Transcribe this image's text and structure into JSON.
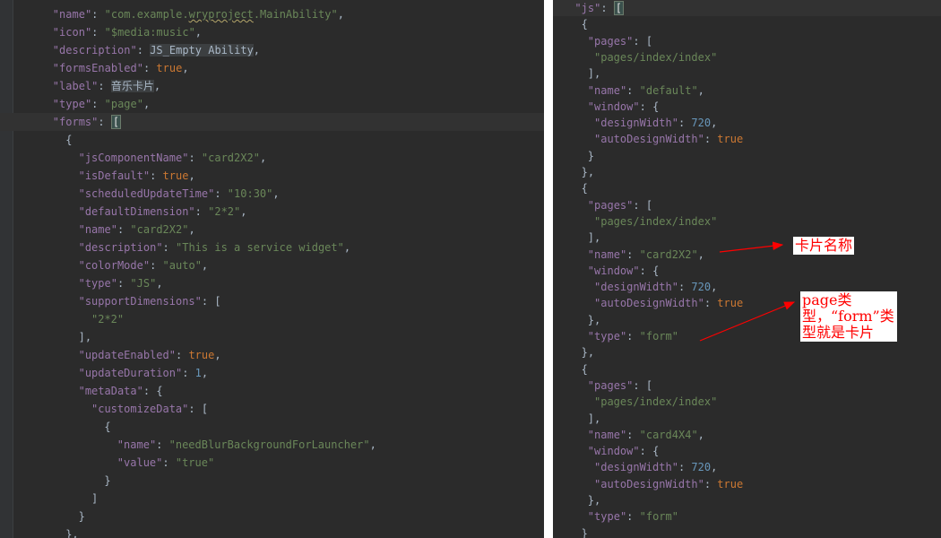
{
  "left_editor": {
    "lines": [
      {
        "ind": 4,
        "key": "name",
        "val": "com.example.",
        "val2": "wryproject",
        "val3": ".MainAbility",
        "kind": "str3"
      },
      {
        "ind": 4,
        "key": "icon",
        "val": "$media:music",
        "kind": "str"
      },
      {
        "ind": 4,
        "key": "description",
        "val": "JS_Empty Ability",
        "kind": "hlstr"
      },
      {
        "ind": 4,
        "key": "formsEnabled",
        "val": "true",
        "kind": "kw"
      },
      {
        "ind": 4,
        "key": "label",
        "val": "音乐卡片",
        "kind": "hlstr"
      },
      {
        "ind": 4,
        "key": "type",
        "val": "page",
        "kind": "str"
      },
      {
        "ind": 4,
        "key": "forms",
        "val": "[",
        "kind": "open"
      },
      {
        "ind": 6,
        "text": "{",
        "kind": "punct"
      },
      {
        "ind": 8,
        "key": "jsComponentName",
        "val": "card2X2",
        "kind": "str"
      },
      {
        "ind": 8,
        "key": "isDefault",
        "val": "true",
        "kind": "kw"
      },
      {
        "ind": 8,
        "key": "scheduledUpdateTime",
        "val": "10:30",
        "kind": "str"
      },
      {
        "ind": 8,
        "key": "defaultDimension",
        "val": "2*2",
        "kind": "str"
      },
      {
        "ind": 8,
        "key": "name",
        "val": "card2X2",
        "kind": "str"
      },
      {
        "ind": 8,
        "key": "description",
        "val": "This is a service widget",
        "kind": "str"
      },
      {
        "ind": 8,
        "key": "colorMode",
        "val": "auto",
        "kind": "str"
      },
      {
        "ind": 8,
        "key": "type",
        "val": "JS",
        "kind": "str"
      },
      {
        "ind": 8,
        "key": "supportDimensions",
        "val": "[",
        "kind": "openp"
      },
      {
        "ind": 10,
        "val": "2*2",
        "kind": "stronly"
      },
      {
        "ind": 8,
        "text": "],",
        "kind": "punct"
      },
      {
        "ind": 8,
        "key": "updateEnabled",
        "val": "true",
        "kind": "kw"
      },
      {
        "ind": 8,
        "key": "updateDuration",
        "val": "1",
        "kind": "num"
      },
      {
        "ind": 8,
        "key": "metaData",
        "val": "{",
        "kind": "openp"
      },
      {
        "ind": 10,
        "key": "customizeData",
        "val": "[",
        "kind": "openp"
      },
      {
        "ind": 12,
        "text": "{",
        "kind": "punct"
      },
      {
        "ind": 14,
        "key": "name",
        "val": "needBlurBackgroundForLauncher",
        "kind": "str"
      },
      {
        "ind": 14,
        "key": "value",
        "val": "true",
        "kind": "strlast"
      },
      {
        "ind": 12,
        "text": "}",
        "kind": "punct"
      },
      {
        "ind": 10,
        "text": "]",
        "kind": "punct"
      },
      {
        "ind": 8,
        "text": "}",
        "kind": "punct"
      },
      {
        "ind": 6,
        "text": "},",
        "kind": "punct"
      }
    ]
  },
  "right_editor": {
    "lines": [
      {
        "ind": 2,
        "key": "js",
        "val": "[",
        "kind": "open"
      },
      {
        "ind": 3,
        "text": "{",
        "kind": "punct"
      },
      {
        "ind": 4,
        "key": "pages",
        "val": "[",
        "kind": "openp"
      },
      {
        "ind": 5,
        "val": "pages/index/index",
        "kind": "stronly"
      },
      {
        "ind": 4,
        "text": "],",
        "kind": "punct"
      },
      {
        "ind": 4,
        "key": "name",
        "val": "default",
        "kind": "str"
      },
      {
        "ind": 4,
        "key": "window",
        "val": "{",
        "kind": "openp"
      },
      {
        "ind": 5,
        "key": "designWidth",
        "val": "720",
        "kind": "num"
      },
      {
        "ind": 5,
        "key": "autoDesignWidth",
        "val": "true",
        "kind": "kwlast"
      },
      {
        "ind": 4,
        "text": "}",
        "kind": "punct"
      },
      {
        "ind": 3,
        "text": "},",
        "kind": "punct"
      },
      {
        "ind": 3,
        "text": "{",
        "kind": "punct"
      },
      {
        "ind": 4,
        "key": "pages",
        "val": "[",
        "kind": "openp"
      },
      {
        "ind": 5,
        "val": "pages/index/index",
        "kind": "stronly"
      },
      {
        "ind": 4,
        "text": "],",
        "kind": "punct"
      },
      {
        "ind": 4,
        "key": "name",
        "val": "card2X2",
        "kind": "str"
      },
      {
        "ind": 4,
        "key": "window",
        "val": "{",
        "kind": "openp"
      },
      {
        "ind": 5,
        "key": "designWidth",
        "val": "720",
        "kind": "num"
      },
      {
        "ind": 5,
        "key": "autoDesignWidth",
        "val": "true",
        "kind": "kwlast"
      },
      {
        "ind": 4,
        "text": "},",
        "kind": "punct"
      },
      {
        "ind": 4,
        "key": "type",
        "val": "form",
        "kind": "strlast"
      },
      {
        "ind": 3,
        "text": "},",
        "kind": "punct"
      },
      {
        "ind": 3,
        "text": "{",
        "kind": "punct"
      },
      {
        "ind": 4,
        "key": "pages",
        "val": "[",
        "kind": "openp"
      },
      {
        "ind": 5,
        "val": "pages/index/index",
        "kind": "stronly"
      },
      {
        "ind": 4,
        "text": "],",
        "kind": "punct"
      },
      {
        "ind": 4,
        "key": "name",
        "val": "card4X4",
        "kind": "str"
      },
      {
        "ind": 4,
        "key": "window",
        "val": "{",
        "kind": "openp"
      },
      {
        "ind": 5,
        "key": "designWidth",
        "val": "720",
        "kind": "num"
      },
      {
        "ind": 5,
        "key": "autoDesignWidth",
        "val": "true",
        "kind": "kwlast"
      },
      {
        "ind": 4,
        "text": "},",
        "kind": "punct"
      },
      {
        "ind": 4,
        "key": "type",
        "val": "form",
        "kind": "strlast"
      },
      {
        "ind": 3,
        "text": "}",
        "kind": "punct"
      }
    ]
  },
  "annotations": {
    "card_name": "卡片名称",
    "type_note": "page类型，“form”类型就是卡片"
  },
  "colors": {
    "background": "#2b2b2b",
    "key": "#9876aa",
    "string": "#6a8759",
    "keyword": "#cc7832",
    "number": "#6897bb",
    "annotation": "#ff0000"
  }
}
